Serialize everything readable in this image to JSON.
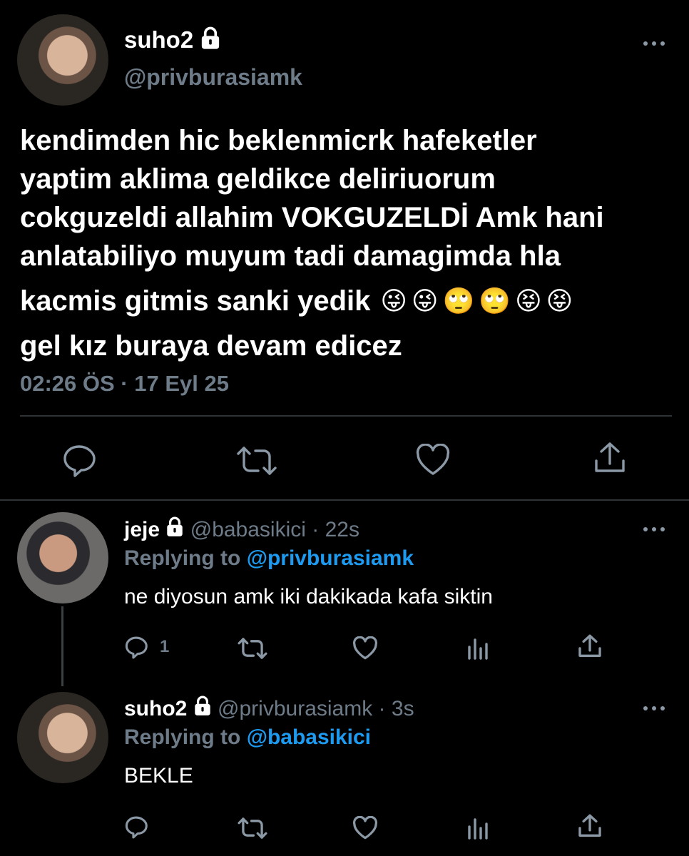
{
  "main_tweet": {
    "display_name": "suho2",
    "handle": "@privburasiamk",
    "lines": [
      "kendimden hic beklenmicrk hafeketler",
      "yaptim aklima geldikce deliriuorum",
      "cokguzeldi allahim VOKGUZELDİ Amk hani",
      "anlatabiliyo muyum tadi damagimda hla",
      "kacmis gitmis sanki yedik",
      "gel kız buraya devam edicez"
    ],
    "emoji": [
      "😜",
      "😜",
      "🙄",
      "🙄",
      "😝",
      "😝"
    ],
    "timestamp": "02:26 ÖS · 17 Eyl 25"
  },
  "reply1": {
    "display_name": "jeje",
    "handle_time": "@babasikici · 22s",
    "replying_prefix": "Replying to",
    "replying_handle": "@privburasiamk",
    "text": "ne diyosun amk iki dakikada kafa siktin",
    "reply_count": "1"
  },
  "reply2": {
    "display_name": "suho2",
    "handle_time": "@privburasiamk · 3s",
    "replying_prefix": "Replying to",
    "replying_handle": "@babasikici",
    "text": "BEKLE"
  },
  "colors": {
    "background": "#000000",
    "muted": "#6e7b88",
    "link": "#1d9bf0",
    "divider": "#2f3336"
  },
  "icons": [
    "lock-icon",
    "more-icon",
    "reply-icon",
    "retweet-icon",
    "like-icon",
    "share-icon",
    "analytics-icon"
  ]
}
